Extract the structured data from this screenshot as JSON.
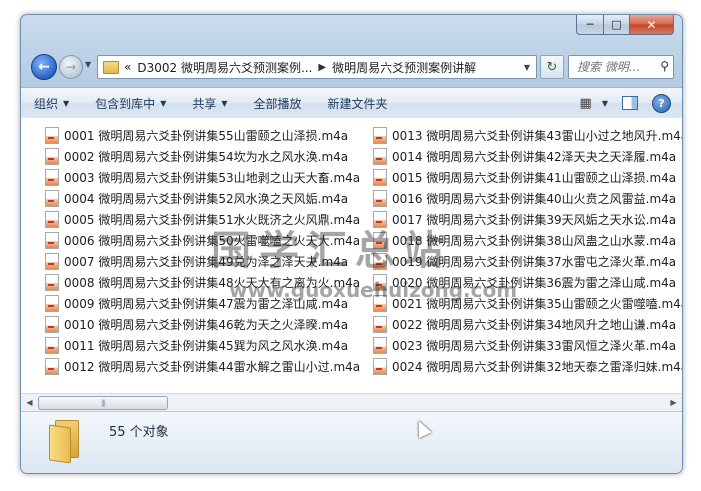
{
  "window": {
    "caption": {
      "minimize": "─",
      "maximize": "□",
      "close": "✕"
    }
  },
  "nav": {
    "back_glyph": "←",
    "forward_glyph": "→",
    "dropdown_glyph": "▼",
    "breadcrumb_prefix": "«",
    "breadcrumb": [
      "D3002 微明周易六爻预测案例...",
      "微明周易六爻预测案例讲解"
    ],
    "breadcrumb_sep": "▶",
    "address_dropdown": "▼",
    "refresh_glyph": "↻",
    "search_placeholder": "搜索 微明...",
    "search_icon": "⚲"
  },
  "toolbar": {
    "organize": "组织",
    "include_library": "包含到库中",
    "share": "共享",
    "play_all": "全部播放",
    "new_folder": "新建文件夹",
    "arrow": "▼",
    "views_glyph": "▦",
    "help": "?"
  },
  "files": {
    "left": [
      "0001 微明周易六爻卦例讲集55山雷颐之山泽损.m4a",
      "0002 微明周易六爻卦例讲集54坎为水之风水涣.m4a",
      "0003 微明周易六爻卦例讲集53山地剥之山天大畜.m4a",
      "0004 微明周易六爻卦例讲集52风水涣之天风姤.m4a",
      "0005 微明周易六爻卦例讲集51水火既济之火风鼎.m4a",
      "0006 微明周易六爻卦例讲集50火雷噬嗑之火天大.m4a",
      "0007 微明周易六爻卦例讲集49兑为泽之泽天夬.m4a",
      "0008 微明周易六爻卦例讲集48火天大有之离为火.m4a",
      "0009 微明周易六爻卦例讲集47震为雷之泽山咸.m4a",
      "0010 微明周易六爻卦例讲集46乾为天之火泽睽.m4a",
      "0011 微明周易六爻卦例讲集45巽为风之风水涣.m4a",
      "0012 微明周易六爻卦例讲集44雷水解之雷山小过.m4a"
    ],
    "right": [
      "0013 微明周易六爻卦例讲集43雷山小过之地风升.m4a",
      "0014 微明周易六爻卦例讲集42泽天夬之天泽履.m4a",
      "0015 微明周易六爻卦例讲集41山雷颐之山泽损.m4a",
      "0016 微明周易六爻卦例讲集40山火贲之风雷益.m4a",
      "0017 微明周易六爻卦例讲集39天风姤之天水讼.m4a",
      "0018 微明周易六爻卦例讲集38山风蛊之山水蒙.m4a",
      "0019 微明周易六爻卦例讲集37水雷屯之泽火革.m4a",
      "0020 微明周易六爻卦例讲集36震为雷之泽山咸.m4a",
      "0021 微明周易六爻卦例讲集35山雷颐之火雷噬嗑.m4a",
      "0022 微明周易六爻卦例讲集34地风升之地山谦.m4a",
      "0023 微明周易六爻卦例讲集33雷风恒之泽火革.m4a",
      "0024 微明周易六爻卦例讲集32地天泰之雷泽归妹.m4a"
    ]
  },
  "watermark": {
    "title": "国学汇总站",
    "url": "www.guoxuehuizong.com"
  },
  "scrollbar": {
    "left": "◀",
    "right": "▶",
    "grip": "|||"
  },
  "status": {
    "count": "55 个对象"
  }
}
